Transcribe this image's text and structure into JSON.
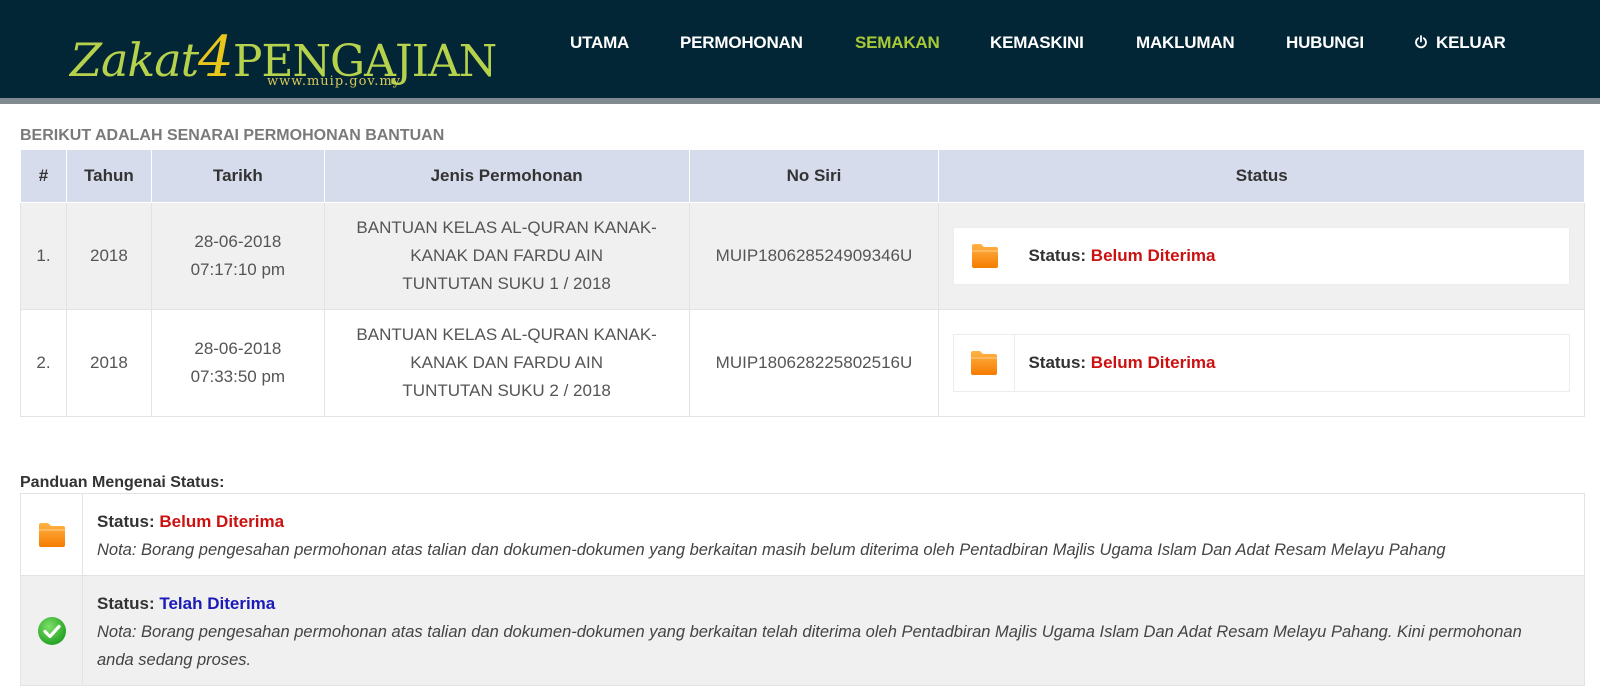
{
  "header": {
    "logo": {
      "main": "Zakat",
      "four": "4",
      "rest": "PENGAJIAN",
      "url": "www.muip.gov.my"
    },
    "nav": [
      {
        "label": "UTAMA",
        "active": false
      },
      {
        "label": "PERMOHONAN",
        "active": false
      },
      {
        "label": "SEMAKAN",
        "active": true
      },
      {
        "label": "KEMASKINI",
        "active": false
      },
      {
        "label": "MAKLUMAN",
        "active": false
      },
      {
        "label": "HUBUNGI",
        "active": false
      },
      {
        "label": "KELUAR",
        "active": false,
        "icon": "power-icon"
      }
    ],
    "colors": {
      "bg": "#032637",
      "active": "#a8c935"
    }
  },
  "section_title": "BERIKUT ADALAH SENARAI PERMOHONAN BANTUAN",
  "table": {
    "headers": [
      "#",
      "Tahun",
      "Tarikh",
      "Jenis Permohonan",
      "No Siri",
      "Status"
    ],
    "rows": [
      {
        "no": "1.",
        "tahun": "2018",
        "tarikh_date": "28-06-2018",
        "tarikh_time": "07:17:10 pm",
        "jenis_1": "BANTUAN KELAS AL-QURAN KANAK-",
        "jenis_2": "KANAK DAN FARDU AIN",
        "jenis_3": "TUNTUTAN SUKU 1 / 2018",
        "no_siri": "MUIP180628524909346U",
        "status_label": "Status:",
        "status_value": "Belum Diterima",
        "status_icon": "folder-icon"
      },
      {
        "no": "2.",
        "tahun": "2018",
        "tarikh_date": "28-06-2018",
        "tarikh_time": "07:33:50 pm",
        "jenis_1": "BANTUAN KELAS AL-QURAN KANAK-",
        "jenis_2": "KANAK DAN FARDU AIN",
        "jenis_3": "TUNTUTAN SUKU 2 / 2018",
        "no_siri": "MUIP180628225802516U",
        "status_label": "Status:",
        "status_value": "Belum Diterima",
        "status_icon": "folder-icon"
      }
    ]
  },
  "guide": {
    "title": "Panduan Mengenai Status:",
    "items": [
      {
        "icon": "folder-icon",
        "label": "Status:",
        "value": "Belum Diterima",
        "value_color": "#cc1111",
        "nota_1": "Nota: Borang pengesahan permohonan atas talian dan dokumen-dokumen yang berkaitan masih belum diterima oleh Pentadbiran Majlis Ugama Islam Dan Adat Resam Melayu Pahang",
        "nota_2": ""
      },
      {
        "icon": "check-circle-icon",
        "label": "Status:",
        "value": "Telah Diterima",
        "value_color": "#1a1ab8",
        "nota_1": "Nota: Borang pengesahan permohonan atas talian dan dokumen-dokumen yang berkaitan telah diterima oleh Pentadbiran Majlis Ugama Islam Dan Adat Resam Melayu Pahang. Kini permohonan",
        "nota_2": "anda sedang proses."
      }
    ]
  }
}
